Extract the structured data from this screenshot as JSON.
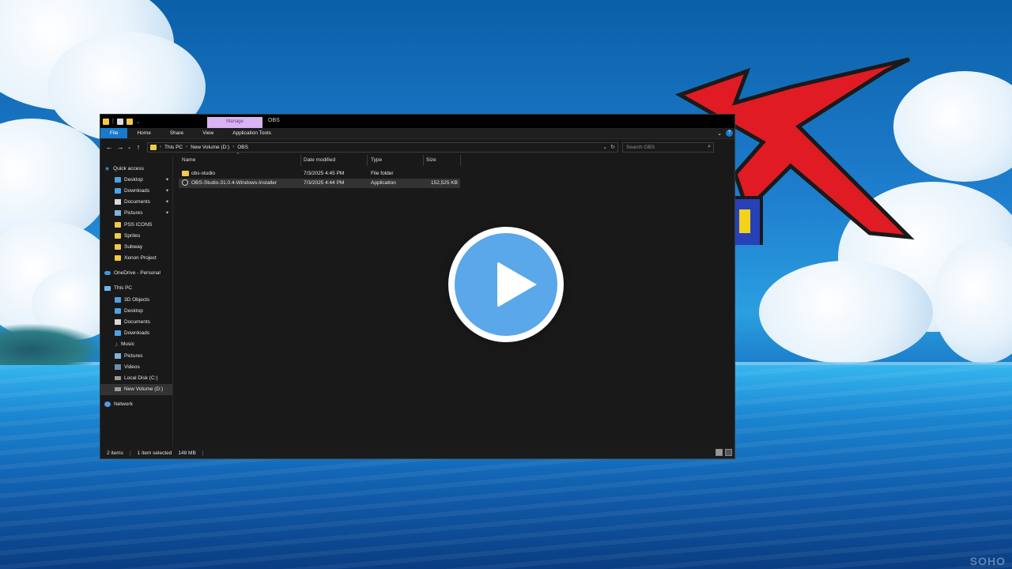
{
  "titlebar": {
    "context_tab": "Manage",
    "window_title": "OBS"
  },
  "ribbon": {
    "tabs": [
      "File",
      "Home",
      "Share",
      "View",
      "Application Tools"
    ]
  },
  "address": {
    "crumbs": [
      "This PC",
      "New Volume (D:)",
      "OBS"
    ]
  },
  "search": {
    "placeholder": "Search OBS"
  },
  "nav": {
    "quick_access": "Quick access",
    "pinned": [
      "Desktop",
      "Downloads",
      "Documents",
      "Pictures"
    ],
    "folders": [
      "PSS ICONS",
      "Sprites",
      "Subway",
      "Xenon Project"
    ],
    "onedrive": "OneDrive - Personal",
    "this_pc": "This PC",
    "pc_items": [
      "3D Objects",
      "Desktop",
      "Documents",
      "Downloads",
      "Music",
      "Pictures",
      "Videos",
      "Local Disk (C:)",
      "New Volume (D:)"
    ],
    "network": "Network"
  },
  "columns": [
    "Name",
    "Date modified",
    "Type",
    "Size"
  ],
  "files": [
    {
      "name": "obs-studio",
      "date": "7/3/2025 4:45 PM",
      "type": "File folder",
      "size": ""
    },
    {
      "name": "OBS-Studio-31.0.4-Windows-Installer",
      "date": "7/3/2025 4:44 PM",
      "type": "Application",
      "size": "152,525 KB"
    }
  ],
  "status": {
    "count": "2 items",
    "selected": "1 item selected",
    "size": "148 MB"
  },
  "colors": {
    "accent": "#1979ca",
    "play": "#5aa7ea",
    "folder": "#f2c94c",
    "context_tab": "#d9b3f2"
  },
  "icons": {
    "play": "play-button-icon",
    "folder": "folder-icon",
    "app": "obs-app-icon"
  }
}
